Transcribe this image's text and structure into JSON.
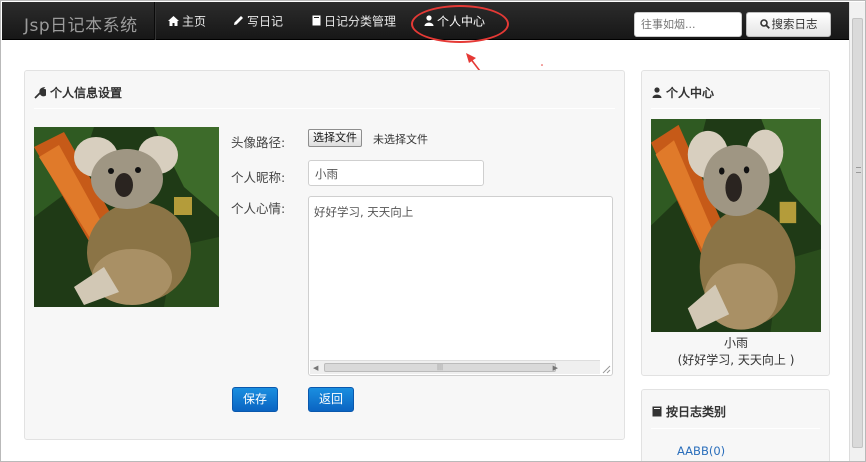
{
  "navbar": {
    "brand": "Jsp日记本系统",
    "items": [
      {
        "label": "主页",
        "icon": "home-icon"
      },
      {
        "label": "写日记",
        "icon": "pencil-icon"
      },
      {
        "label": "日记分类管理",
        "icon": "book-icon"
      },
      {
        "label": "个人中心",
        "icon": "user-icon"
      }
    ],
    "search_placeholder": "往事如烟...",
    "search_button": "搜索日志"
  },
  "settings": {
    "title": "个人信息设置",
    "avatar_label": "头像路径:",
    "choose_file": "选择文件",
    "no_file": "未选择文件",
    "nickname_label": "个人昵称:",
    "nickname_value": "小雨",
    "mood_label": "个人心情:",
    "mood_value": "好好学习, 天天向上",
    "save": "保存",
    "back": "返回"
  },
  "profile": {
    "title": "个人中心",
    "name": "小雨",
    "mood": "(好好学习, 天天向上 )"
  },
  "categories": {
    "title": "按日志类别",
    "items": [
      "AABB(0)"
    ]
  },
  "colors": {
    "accent_red": "#e53935",
    "primary_blue": "#0b64c2",
    "link_blue": "#2a6ebb"
  }
}
